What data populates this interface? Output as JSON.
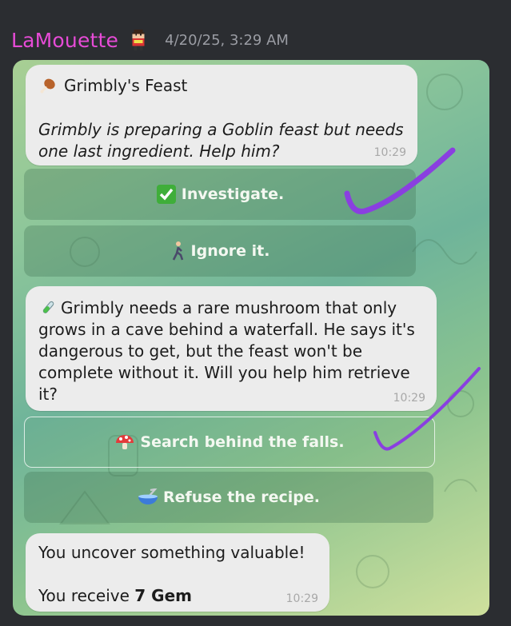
{
  "header": {
    "username": "LaMouette",
    "avatar_icon": "pixel-character-icon",
    "timestamp": "4/20/25, 3:29 AM"
  },
  "messages": [
    {
      "title_icon": "drumstick-icon",
      "title": "Grimbly's Feast",
      "body": "Grimbly is preparing a Goblin feast but needs one last ingredient. Help him?",
      "time": "10:29"
    },
    {
      "icon": "test-tube-icon",
      "body": "Grimbly needs a rare mushroom that only grows in a cave behind a waterfall. He says it's dangerous to get, but the feast won't be complete without it. Will you help him retrieve it?",
      "time": "10:29"
    },
    {
      "line1": "You uncover something valuable!",
      "line2_prefix": "You receive",
      "line2_amount": "7 Gem",
      "time": "10:29"
    }
  ],
  "buttons": [
    {
      "icon": "check-mark-button-icon",
      "label": "Investigate."
    },
    {
      "icon": "person-walking-icon",
      "label": "Ignore it."
    },
    {
      "icon": "mushroom-icon",
      "label": "Search behind the falls."
    },
    {
      "icon": "bowl-with-spoon-icon",
      "label": "Refuse the recipe."
    }
  ],
  "colors": {
    "username": "#e64bd6",
    "timestamp": "#9a9ca3",
    "annotation_check": "#8a3fe0"
  }
}
